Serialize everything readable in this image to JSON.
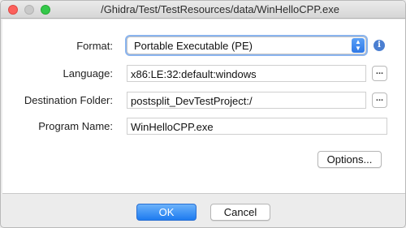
{
  "window": {
    "title": "/Ghidra/Test/TestResources/data/WinHelloCPP.exe"
  },
  "form": {
    "format_label": "Format:",
    "format_value": "Portable Executable (PE)",
    "language_label": "Language:",
    "language_value": "x86:LE:32:default:windows",
    "destination_label": "Destination Folder:",
    "destination_value": "postsplit_DevTestProject:/",
    "program_name_label": "Program Name:",
    "program_name_value": "WinHelloCPP.exe",
    "browse_label": "...",
    "info_glyph": "i"
  },
  "buttons": {
    "options": "Options...",
    "ok": "OK",
    "cancel": "Cancel"
  },
  "colors": {
    "accent": "#1d7bf0",
    "info_icon": "#4b7fd1"
  }
}
